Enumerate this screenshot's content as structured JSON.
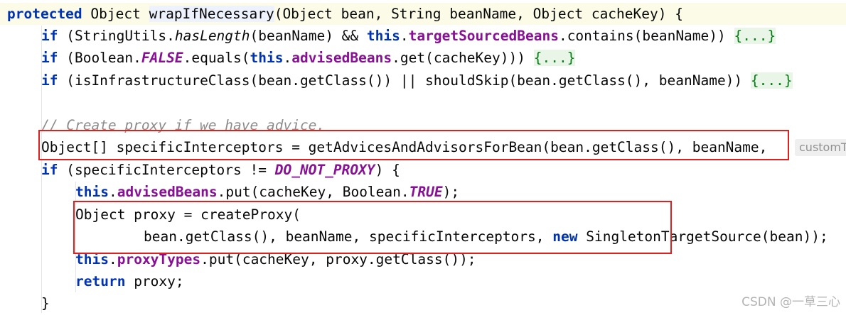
{
  "code": {
    "line1": {
      "kw": "protected",
      "sp": " Object ",
      "method": "wrapIfNecessary",
      "rest": "(Object bean, String beanName, Object cacheKey) {"
    },
    "line2": {
      "if": "if",
      "a": " (StringUtils.",
      "m": "hasLength",
      "b": "(beanName) && ",
      "this": "this",
      "dot": ".",
      "field": "targetSourcedBeans",
      "c": ".contains(beanName)) ",
      "fold": "{...}"
    },
    "line3": {
      "if": "if",
      "a": " (Boolean.",
      "const": "FALSE",
      "b": ".equals(",
      "this": "this",
      "dot": ".",
      "field": "advisedBeans",
      "c": ".get(cacheKey))) ",
      "fold": "{...}"
    },
    "line4": {
      "if": "if",
      "a": " (isInfrastructureClass(bean.getClass()) || shouldSkip(bean.getClass(), beanName)) ",
      "fold": "{...}"
    },
    "line6": {
      "comment": "// Create proxy if we have advice."
    },
    "line7": {
      "text": "Object[] specificInterceptors = getAdvicesAndAdvisorsForBean(bean.getClass(), beanName, "
    },
    "line7_hint": "customT",
    "line8": {
      "if": "if",
      "a": " (specificInterceptors != ",
      "const": "DO_NOT_PROXY",
      "b": ") {"
    },
    "line9": {
      "this": "this",
      "dot": ".",
      "field": "advisedBeans",
      "a": ".put(cacheKey, Boolean.",
      "const": "TRUE",
      "b": ");"
    },
    "line10": {
      "text": "Object proxy = createProxy("
    },
    "line11": {
      "a": "bean.getClass(), beanName, specificInterceptors, ",
      "new": "new",
      "b": " SingletonTargetSource(bean));"
    },
    "line12": {
      "this": "this",
      "dot": ".",
      "field": "proxyTypes",
      "a": ".put(cacheKey, proxy.getClass());"
    },
    "line13": {
      "kw": "return",
      "a": " proxy;"
    },
    "line14": {
      "text": "}"
    }
  },
  "watermark": "CSDN @一草三心",
  "colors": {
    "keyword": "#0033b3",
    "field": "#871094",
    "fold": "#067d17",
    "comment": "#8c8c8c",
    "highlight_box": "#e01f1f"
  }
}
